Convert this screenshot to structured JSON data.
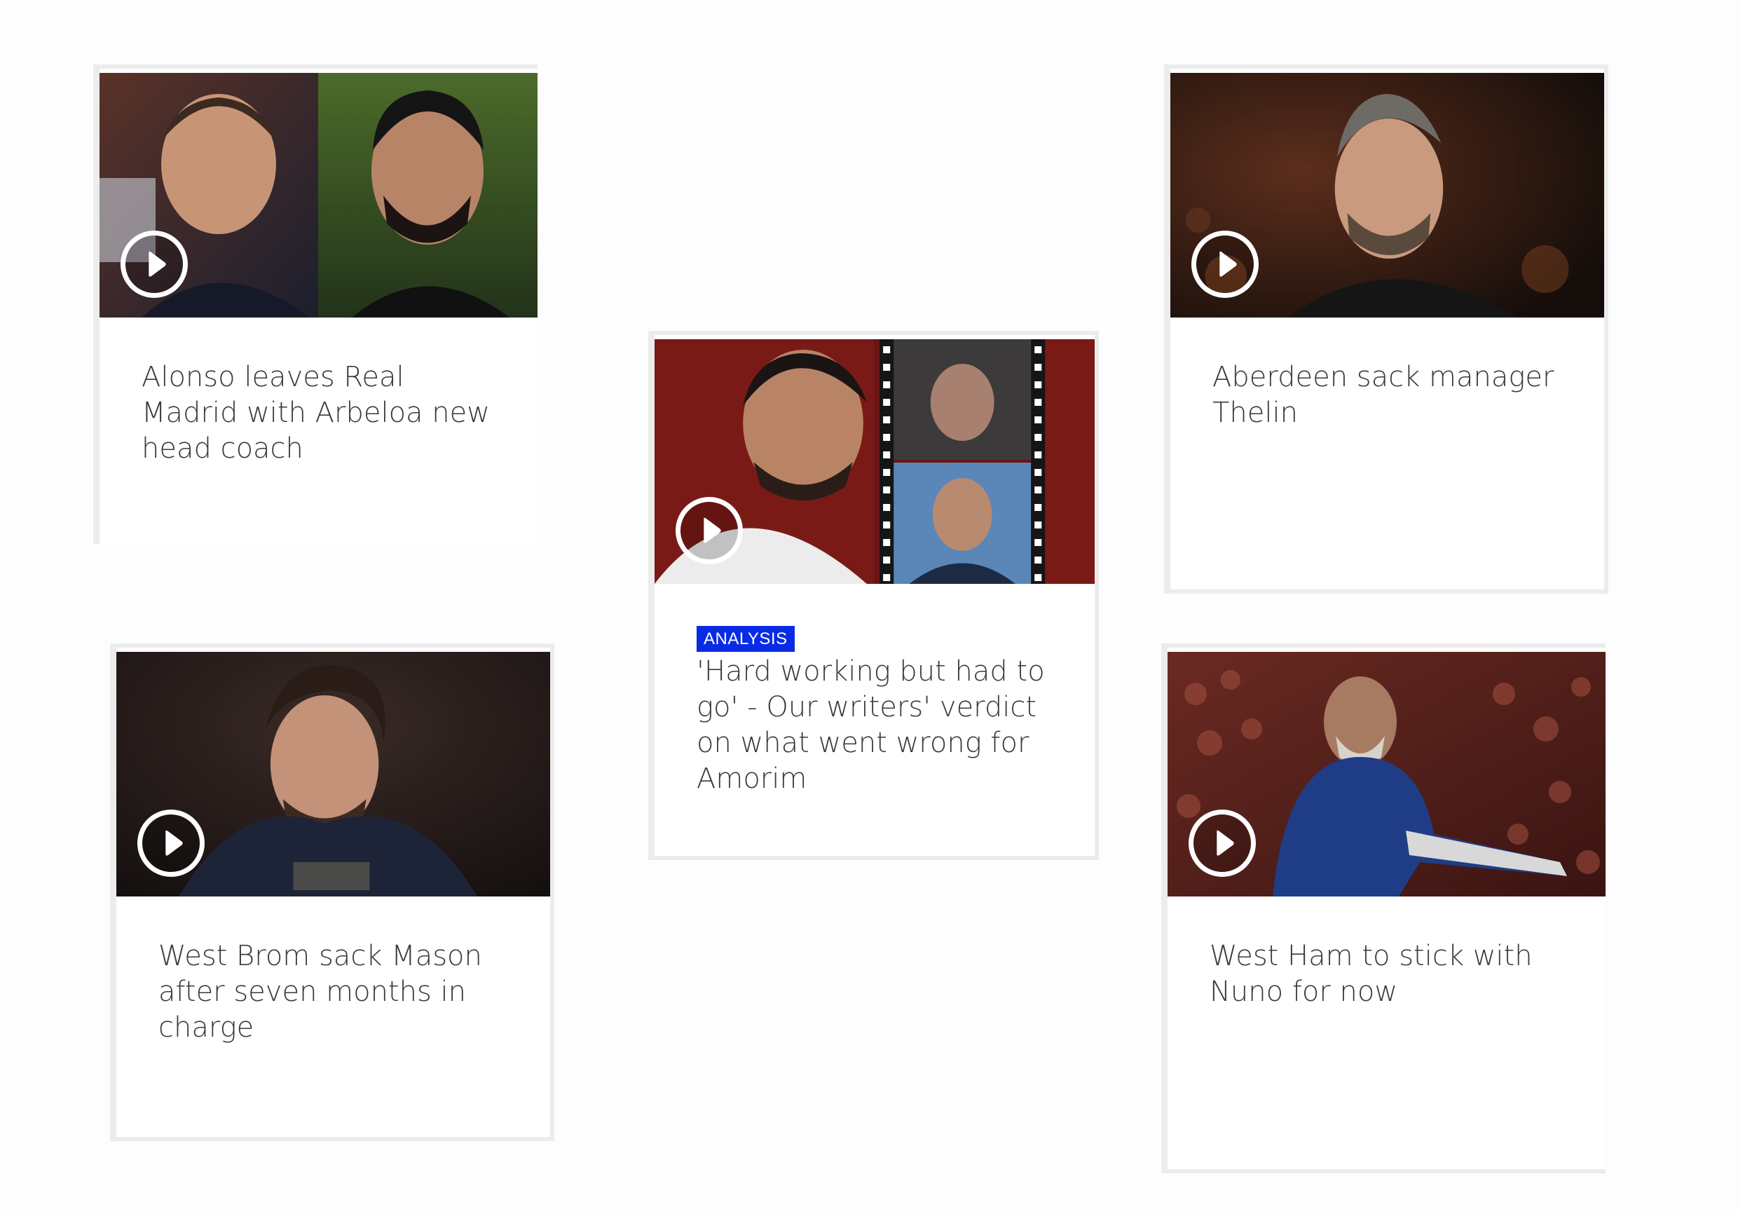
{
  "cards": [
    {
      "id": "a",
      "headline": "Alonso leaves Real Madrid with Arbeloa new head coach",
      "has_video": true,
      "play_icon": "play-circle-icon"
    },
    {
      "id": "b",
      "headline": "Aberdeen sack manager Thelin",
      "has_video": true,
      "play_icon": "play-circle-icon"
    },
    {
      "id": "c",
      "tag": "ANALYSIS",
      "headline": "'Hard working but had to go' - Our writers' verdict on what went wrong for Amorim",
      "has_video": true,
      "play_icon": "play-circle-icon"
    },
    {
      "id": "d",
      "headline": "West Brom sack Mason after seven months in charge",
      "has_video": true,
      "play_icon": "play-circle-icon"
    },
    {
      "id": "e",
      "headline": "West Ham to stick with Nuno for now",
      "has_video": true,
      "play_icon": "play-circle-icon"
    }
  ],
  "colors": {
    "tag_background": "#0a2be6",
    "headline_text": "#3a3a3a",
    "card_border": "#ececec"
  }
}
